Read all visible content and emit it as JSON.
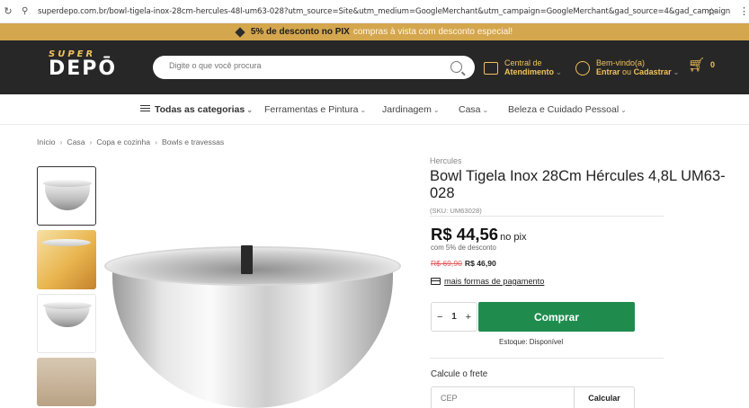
{
  "browser": {
    "url": "superdepo.com.br/bowl-tigela-inox-28cm-hercules-48l-um63-028?utm_source=Site&utm_medium=GoogleMerchant&utm_campaign=GoogleMerchant&gad_source=4&gad_campaignid=219..."
  },
  "promo": {
    "highlight": "5% de desconto no PIX",
    "rest": "compras à vista com desconto especial!"
  },
  "header": {
    "logo_top": "SUPER",
    "logo_bottom": "DEPŌ",
    "search_placeholder": "Digite o que você procura",
    "support_line1": "Central de",
    "support_line2": "Atendimento",
    "user_line1": "Bem-vindo(a)",
    "user_login": "Entrar",
    "user_or": "ou",
    "user_register": "Cadastrar",
    "cart_count": "0"
  },
  "categories": {
    "all": "Todas as categorias",
    "items": [
      "Ferramentas e Pintura",
      "Jardinagem",
      "Casa",
      "Beleza e Cuidado Pessoal"
    ]
  },
  "breadcrumb": [
    "Início",
    "Casa",
    "Copa e cozinha",
    "Bowls e travessas"
  ],
  "product": {
    "brand": "Hercules",
    "title": "Bowl Tigela Inox 28Cm Hércules 4,8L UM63-028",
    "sku": "(SKU: UM63028)",
    "price_pix": "R$ 44,56",
    "price_pix_suffix": "no pix",
    "discount_note": "com 5% de desconto",
    "old_price": "R$ 69,90",
    "price": "R$ 46,90",
    "payment_link": "mais formas de pagamento",
    "quantity": "1",
    "minus": "−",
    "plus": "+",
    "buy_label": "Comprar",
    "stock": "Estoque: Disponível",
    "freight_title": "Calcule o frete",
    "cep_placeholder": "CEP",
    "calc_label": "Calcular"
  }
}
